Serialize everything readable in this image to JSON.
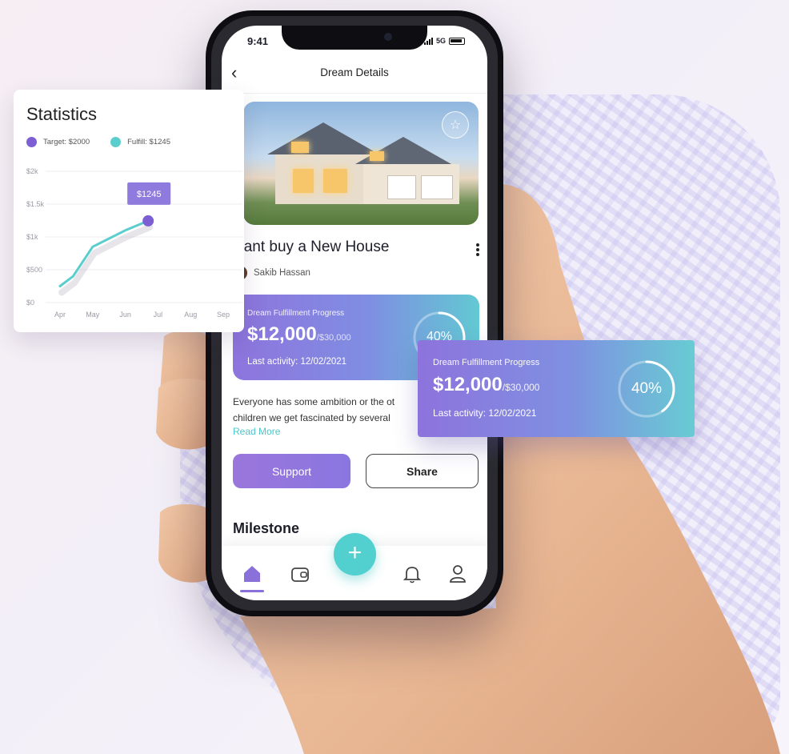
{
  "status_bar": {
    "time": "9:41",
    "network": "5G"
  },
  "header": {
    "title": "Dream Details"
  },
  "dream": {
    "title": "want buy a New House",
    "author": "Sakib Hassan",
    "description_line1": "Everyone has some ambition or the ot",
    "description_line2": "children we get fascinated by several",
    "read_more": "Read More"
  },
  "progress": {
    "label": "Dream Fulfillment Progress",
    "amount": "$12,000",
    "target": "/$30,000",
    "last_activity": "Last activity: 12/02/2021",
    "percent_text": "40%",
    "fraction": 0.4
  },
  "float_progress": {
    "label": "Dream Fulfillment Progress",
    "amount": "$12,000",
    "target": "/$30,000",
    "last_activity": "Last activity: 12/02/2021",
    "percent_text": "40%",
    "fraction": 0.4
  },
  "actions": {
    "support": "Support",
    "share": "Share",
    "fab": "+"
  },
  "section": {
    "milestone": "Milestone"
  },
  "tabs": [
    {
      "icon": "home-icon",
      "active": true
    },
    {
      "icon": "wallet-icon",
      "active": false
    },
    {
      "icon": "bell-icon",
      "active": false
    },
    {
      "icon": "profile-icon",
      "active": false
    }
  ],
  "colors": {
    "accent_purple": "#8a70d9",
    "accent_teal": "#52cfcf",
    "target": "#7d5fd4",
    "fulfill": "#5ccdcd"
  },
  "statistics": {
    "title": "Statistics"
  },
  "chart_data": {
    "type": "line",
    "legend": [
      "Target: $2000",
      "Fulfill: $1245"
    ],
    "categories": [
      "Apr",
      "May",
      "Jun",
      "Jul",
      "Aug",
      "Sep"
    ],
    "y_ticks": [
      "$0",
      "$500",
      "$1k",
      "$1.5k",
      "$2k"
    ],
    "ylim": [
      0,
      2000
    ],
    "series": [
      {
        "name": "Fulfill: $1245",
        "x": [
          0,
          0.4,
          1.0,
          2.0,
          2.7
        ],
        "values": [
          250,
          400,
          850,
          1100,
          1245
        ]
      }
    ],
    "tooltip": "$1245",
    "grid": true
  }
}
